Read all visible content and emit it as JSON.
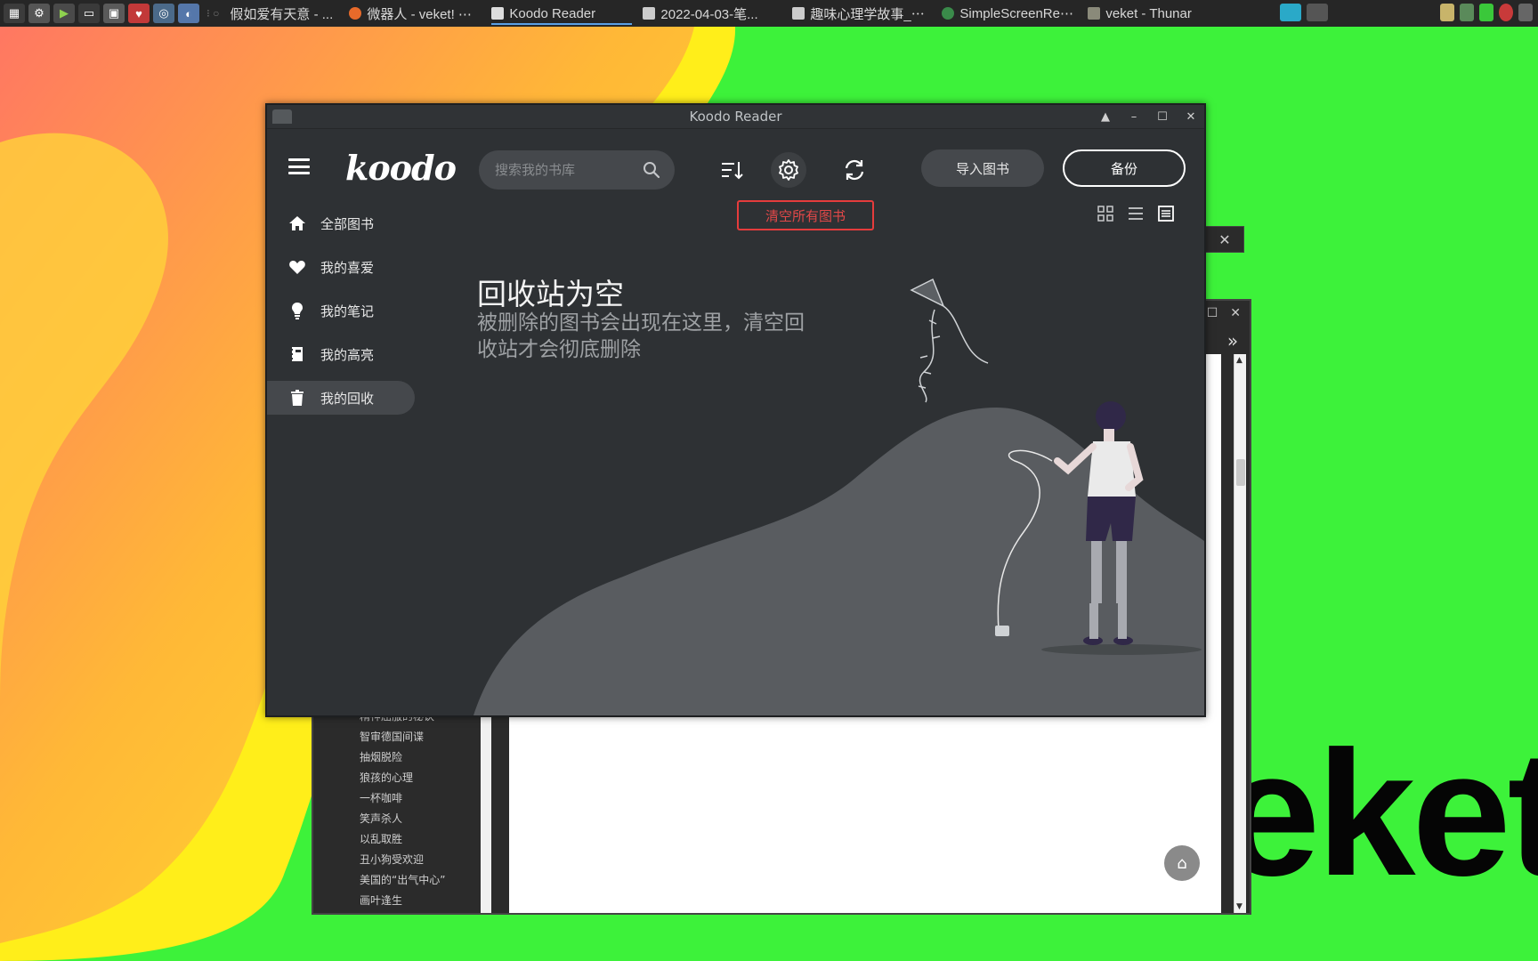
{
  "taskbar": {
    "launchers": [
      "system-monitor",
      "settings",
      "media-player",
      "terminal",
      "screenshot",
      "app-red",
      "app-blue",
      "browser"
    ],
    "tasks": [
      {
        "label": "假如爱有天意 - ...",
        "active": false
      },
      {
        "label": "微器人 - veket! ⋯",
        "active": false
      },
      {
        "label": "Koodo Reader",
        "active": true
      },
      {
        "label": "2022-04-03-笔...",
        "active": false
      },
      {
        "label": "趣味心理学故事_⋯",
        "active": false
      },
      {
        "label": "SimpleScreenRe⋯",
        "active": false
      },
      {
        "label": "veket - Thunar",
        "active": false
      }
    ]
  },
  "window": {
    "title": "Koodo Reader",
    "controls": [
      "▲",
      "–",
      "☐",
      "✕"
    ]
  },
  "header": {
    "logo": "koodo",
    "search_placeholder": "搜索我的书库",
    "import_label": "导入图书",
    "backup_label": "备份"
  },
  "toolbar": {
    "clear_all_label": "清空所有图书"
  },
  "sidebar": {
    "items": [
      {
        "label": "全部图书",
        "icon": "home-icon",
        "active": false
      },
      {
        "label": "我的喜爱",
        "icon": "heart-icon",
        "active": false
      },
      {
        "label": "我的笔记",
        "icon": "bulb-icon",
        "active": false
      },
      {
        "label": "我的高亮",
        "icon": "highlight-icon",
        "active": false
      },
      {
        "label": "我的回收",
        "icon": "trash-icon",
        "active": true
      }
    ]
  },
  "main": {
    "empty_title": "回收站为空",
    "empty_desc": "被删除的图书会出现在这里，清空回收站才会彻底删除"
  },
  "background_window": {
    "toc_items": [
      "精神屈服的秘诀",
      "智审德国间谍",
      "抽烟脱险",
      "狼孩的心理",
      "一杯咖啡",
      "笑声杀人",
      "以乱取胜",
      "丑小狗受欢迎",
      "美国的“出气中心”",
      "画叶逢生"
    ]
  },
  "desktop": {
    "wallpaper_text": "eket"
  },
  "colors": {
    "app_bg": "#2e3134",
    "accent_red": "#e53c3c",
    "desktop_green": "#3df23a"
  }
}
